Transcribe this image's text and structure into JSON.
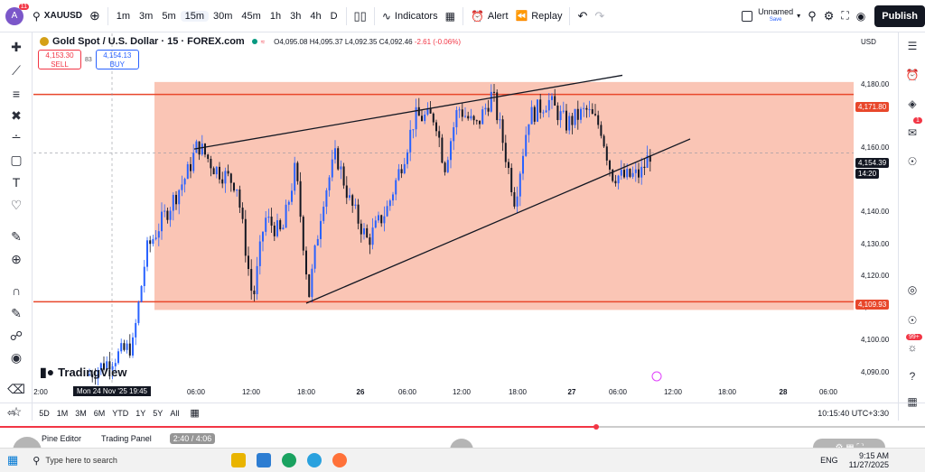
{
  "topbar": {
    "avatar_letter": "A",
    "avatar_badge": "11",
    "symbol": "XAUUSD",
    "timeframes": [
      "1m",
      "3m",
      "5m",
      "15m",
      "30m",
      "45m",
      "1h",
      "3h",
      "4h",
      "D"
    ],
    "active_timeframe": "15m",
    "indicators_label": "Indicators",
    "alert_label": "Alert",
    "replay_label": "Replay",
    "layout_name": "Unnamed",
    "layout_status": "Save",
    "publish_label": "Publish"
  },
  "legend": {
    "title": "Gold Spot / U.S. Dollar · 15 · FOREX.com",
    "open": "O4,095.08",
    "high": "H4,095.37",
    "low": "L4,092.35",
    "close": "C4,092.46",
    "change": "-2.61 (-0.06%)",
    "sell_price": "4,153.30",
    "sell_label": "SELL",
    "spread": "83",
    "buy_price": "4,154.13",
    "buy_label": "BUY"
  },
  "price_axis": {
    "currency": "USD",
    "ticks": [
      "4,180.00",
      "4,160.00",
      "4,140.00",
      "4,130.00",
      "4,120.00",
      "4,110.00",
      "4,100.00",
      "4,090.00"
    ],
    "resistance_label": "4,171.80",
    "support_label": "4,109.93",
    "current_price": "4,154.39",
    "countdown": "14:20"
  },
  "time_axis": {
    "ticks": [
      "2:00",
      "06:00",
      "12:00",
      "18:00",
      "26",
      "06:00",
      "12:00",
      "18:00",
      "27",
      "06:00",
      "12:00",
      "18:00",
      "28",
      "06:00"
    ],
    "crosshair_label": "Mon 24 Nov '25   19:45"
  },
  "branding": {
    "tradingview": "TradingView"
  },
  "bottom": {
    "ranges": [
      "5D",
      "1M",
      "3M",
      "6M",
      "YTD",
      "1Y",
      "5Y",
      "All"
    ],
    "clock": "10:15:40 UTC+3:30",
    "pine_editor": "Pine Editor",
    "trading_panel": "Trading Panel",
    "player_time": "2:40 / 4:06"
  },
  "taskbar": {
    "search_placeholder": "Type here to search",
    "language": "ENG",
    "time": "9:15 AM",
    "date": "11/27/2025",
    "notif_badge": "99+"
  },
  "colors": {
    "zone_fill": "#f9b6a3",
    "level_line": "#e8472b",
    "bull": "#2962ff",
    "bear": "#131722",
    "progress": "#f23645"
  },
  "chart_data": {
    "type": "candlestick",
    "symbol": "XAUUSD",
    "interval": "15",
    "resistance": 4171.8,
    "support": 4109.93,
    "current": 4154.39,
    "ylim": [
      4085,
      4190
    ]
  }
}
